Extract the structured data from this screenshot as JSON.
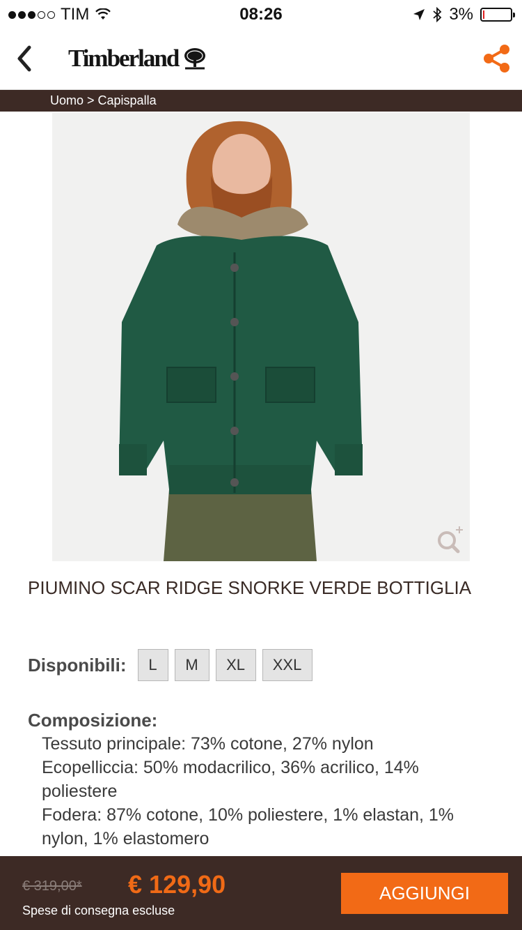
{
  "status_bar": {
    "carrier": "TIM",
    "time": "08:26",
    "battery": "3%",
    "battery_level": 0.03,
    "signal_dots_filled": 3,
    "signal_dots_total": 5
  },
  "header": {
    "back_icon": "chevron-left-icon",
    "logo_text": "Timberland",
    "share_icon": "share-icon",
    "accent_color": "#f26a16"
  },
  "breadcrumb": "Uomo > Capispalla",
  "product": {
    "title": "PIUMINO SCAR RIDGE SNORKE VERDE BOTTIGLIA",
    "sizes_label": "Disponibili:",
    "sizes": [
      "L",
      "M",
      "XL",
      "XXL"
    ],
    "composition_heading": "Composizione:",
    "composition": [
      "Tessuto principale: 73% cotone, 27% nylon",
      "Ecopelliccia: 50% modacrilico, 36% acrilico, 14% poliestere",
      "Fodera: 87% cotone, 10% poliestere, 1% elastan, 1% nylon, 1% elastomero"
    ]
  },
  "purchase": {
    "old_price": "€ 319,00*",
    "price": "€ 129,90",
    "shipping_note": "Spese di consegna escluse",
    "add_button": "AGGIUNGI"
  }
}
